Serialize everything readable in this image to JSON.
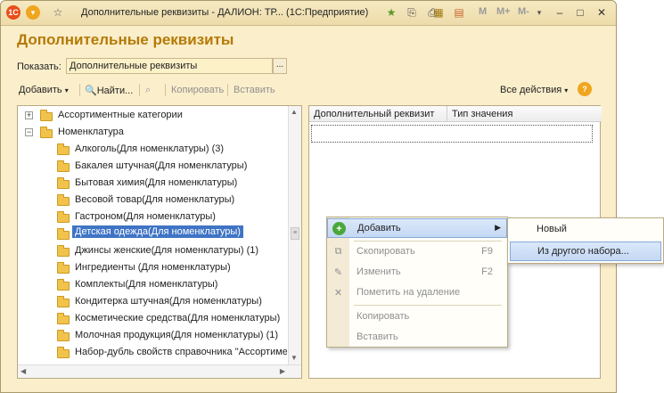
{
  "window": {
    "title": "Дополнительные реквизиты - ДАЛИОН: ТР...  (1С:Предприятие)",
    "app_icon": "1C-logo",
    "toolbar_m_buttons": [
      "M",
      "M+",
      "M-"
    ]
  },
  "heading": "Дополнительные реквизиты",
  "show": {
    "label": "Показать:",
    "value": "Дополнительные реквизиты",
    "button": "..."
  },
  "toolbar": {
    "add": "Добавить",
    "find": "Найти...",
    "copy": "Копировать",
    "paste": "Вставить",
    "all_actions": "Все действия"
  },
  "tree": {
    "items": [
      {
        "label": "Ассортиментные категории",
        "level": 0,
        "expander": "+"
      },
      {
        "label": "Номенклатура",
        "level": 0,
        "expander": "−"
      },
      {
        "label": "Алкоголь(Для номенклатуры) (3)",
        "level": 1
      },
      {
        "label": "Бакалея штучная(Для номенклатуры)",
        "level": 1
      },
      {
        "label": "Бытовая химия(Для номенклатуры)",
        "level": 1
      },
      {
        "label": "Весовой товар(Для номенклатуры)",
        "level": 1
      },
      {
        "label": "Гастроном(Для номенклатуры)",
        "level": 1
      },
      {
        "label": "Детская одежда(Для номенклатуры)",
        "level": 1,
        "selected": true
      },
      {
        "label": "Джинсы женские(Для номенклатуры) (1)",
        "level": 1
      },
      {
        "label": "Ингредиенты (Для номенклатуры)",
        "level": 1
      },
      {
        "label": "Комплекты(Для номенклатуры)",
        "level": 1
      },
      {
        "label": "Кондитерка штучная(Для номенклатуры)",
        "level": 1
      },
      {
        "label": "Косметические средства(Для номенклатуры)",
        "level": 1
      },
      {
        "label": "Молочная продукция(Для номенклатуры) (1)",
        "level": 1
      },
      {
        "label": "Набор-дубль свойств справочника \"Ассортиме",
        "level": 1
      }
    ]
  },
  "table": {
    "columns": [
      "Дополнительный реквизит",
      "Тип значения"
    ]
  },
  "context_menu": {
    "items": [
      {
        "label": "Добавить",
        "shortcut": "",
        "enabled": true,
        "highlighted": true,
        "has_submenu": true
      },
      {
        "label": "Скопировать",
        "shortcut": "F9",
        "enabled": false
      },
      {
        "label": "Изменить",
        "shortcut": "F2",
        "enabled": false
      },
      {
        "label": "Пометить на удаление",
        "shortcut": "",
        "enabled": false
      },
      {
        "label": "Копировать",
        "shortcut": "",
        "enabled": false
      },
      {
        "label": "Вставить",
        "shortcut": "",
        "enabled": false
      }
    ]
  },
  "submenu": {
    "items": [
      {
        "label": "Новый",
        "highlighted": false
      },
      {
        "label": "Из другого набора...",
        "highlighted": true
      }
    ]
  },
  "colors": {
    "accent_heading": "#b47a06",
    "selection": "#3f74c5",
    "window_bg": "#fbeecb"
  }
}
